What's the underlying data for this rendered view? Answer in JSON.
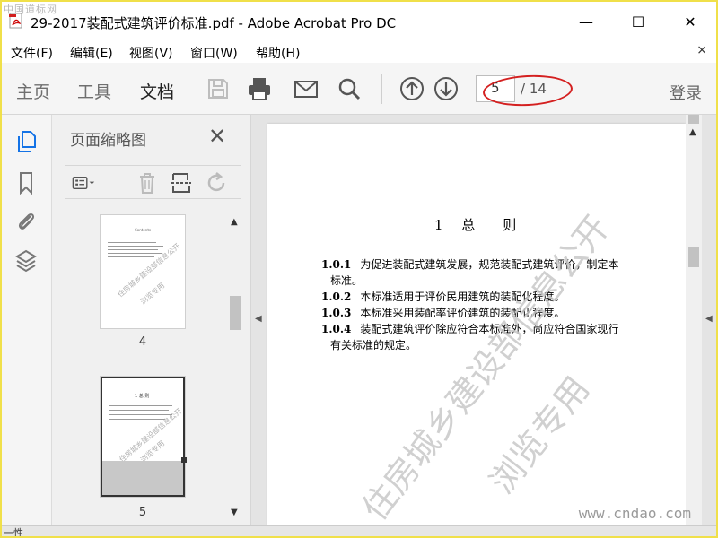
{
  "window": {
    "title": "29-2017装配式建筑评价标准.pdf - Adobe Acrobat Pro DC",
    "top_watermark": "中国道标网",
    "controls": {
      "minimize": "—",
      "maximize": "☐",
      "close": "✕"
    }
  },
  "menu": {
    "items": [
      "文件(F)",
      "编辑(E)",
      "视图(V)",
      "窗口(W)",
      "帮助(H)"
    ],
    "close": "×"
  },
  "toolbar": {
    "tabs": [
      "主页",
      "工具",
      "文档"
    ],
    "active_tab": "文档",
    "page_current": "5",
    "page_total": "/ 14",
    "login": "登录"
  },
  "thumbnails_panel": {
    "title": "页面缩略图",
    "pages": [
      {
        "label": "4",
        "heading": "Contents",
        "watermark": "住房城乡建设部信息公开",
        "watermark2": "浏览专用"
      },
      {
        "label": "5",
        "heading": "1 总 则",
        "watermark": "住房城乡建设部信息公开",
        "watermark2": "浏览专用"
      }
    ]
  },
  "document": {
    "heading": "1 总　则",
    "lines": [
      {
        "num": "1.0.1",
        "text": "为促进装配式建筑发展，规范装配式建筑评价，制定本"
      },
      {
        "num": "",
        "text": "标准。"
      },
      {
        "num": "1.0.2",
        "text": "本标准适用于评价民用建筑的装配化程度。"
      },
      {
        "num": "1.0.3",
        "text": "本标准采用装配率评价建筑的装配化程度。"
      },
      {
        "num": "1.0.4",
        "text": "装配式建筑评价除应符合本标准外，尚应符合国家现行"
      },
      {
        "num": "",
        "text": "有关标准的规定。"
      }
    ],
    "watermark_line1": "住房城乡建设部信息公开",
    "watermark_line2": "浏览专用",
    "site_watermark": "www.cndao.com"
  },
  "status": {
    "text": "一性"
  },
  "colors": {
    "frame": "#f0e04a",
    "annotation": "#d42020",
    "active_tab_underline": "#333333"
  }
}
